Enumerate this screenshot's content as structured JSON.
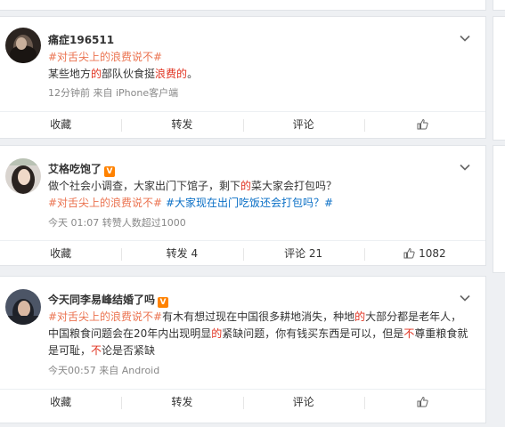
{
  "posts": [
    {
      "author": "痛症196511",
      "vip": false,
      "tag": "#对舌尖上的浪费说不#",
      "text": [
        {
          "t": "某些地方",
          "c": "normal"
        },
        {
          "t": "的",
          "c": "hl"
        },
        {
          "t": "部队伙食挺",
          "c": "normal"
        },
        {
          "t": "浪费的",
          "c": "hl"
        },
        {
          "t": "。",
          "c": "normal"
        }
      ],
      "meta": "12分钟前  来自 iPhone客户端",
      "actions": {
        "collect": "收藏",
        "repost": "转发",
        "comment": "评论",
        "like": ""
      }
    },
    {
      "author": "艾格吃饱了",
      "vip": true,
      "line1": [
        {
          "t": "做个社会小调查，大家出门下馆子，剩下",
          "c": "normal"
        },
        {
          "t": "的",
          "c": "hl"
        },
        {
          "t": "菜大家会打包吗？",
          "c": "normal"
        }
      ],
      "tag": "#对舌尖上的浪费说不#",
      "tag2": "#大家现在出门吃饭还会打包吗？#",
      "meta": "今天 01:07 转赞人数超过1000",
      "actions": {
        "collect": "收藏",
        "repost": "转发 4",
        "comment": "评论 21",
        "like": "1082"
      }
    },
    {
      "author": "今天同李易峰结婚了吗",
      "vip": true,
      "tag": "#对舌尖上的浪费说不#",
      "text": [
        {
          "t": "有木有想过现在中国很多耕地消失，种地",
          "c": "normal"
        },
        {
          "t": "的",
          "c": "hl"
        },
        {
          "t": "大部分都是老年人，中国粮食问题会在20年内出现明显",
          "c": "normal"
        },
        {
          "t": "的",
          "c": "hl"
        },
        {
          "t": "紧缺问题，你有钱买东西是可以，但是",
          "c": "normal"
        },
        {
          "t": "不",
          "c": "hl"
        },
        {
          "t": "尊重粮食就是可耻，",
          "c": "normal"
        },
        {
          "t": "不",
          "c": "hl"
        },
        {
          "t": "论是否紧缺",
          "c": "normal"
        }
      ],
      "meta": "今天00:57  来自 Android",
      "actions": {
        "collect": "收藏",
        "repost": "转发",
        "comment": "评论",
        "like": ""
      }
    }
  ],
  "icons": {
    "chevron": "chevron-down-icon",
    "like": "thumbs-up-icon",
    "vip": "vip-badge-icon"
  },
  "colors": {
    "tag": "#eb7350",
    "link": "#0a6fc6",
    "highlight": "#e0301e",
    "vip": "#ff8200"
  },
  "vip_mark": "V"
}
